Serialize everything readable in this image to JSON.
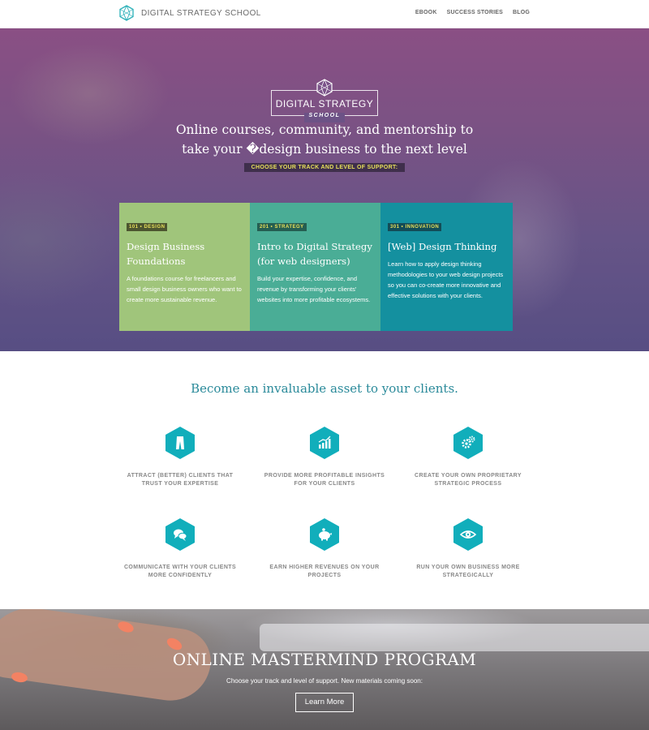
{
  "nav": {
    "logo_text": "DIGITAL STRATEGY SCHOOL",
    "links": [
      "EBOOK",
      "SUCCESS STORIES",
      "BLOG"
    ]
  },
  "hero": {
    "badge_line1": "DIGITAL STRATEGY",
    "badge_line2": "SCHOOL",
    "heading_line1": "Online courses, community, and mentorship to",
    "heading_line2": "take your �design business to the next level",
    "cta_label": "CHOOSE YOUR TRACK AND LEVEL OF SUPPORT:",
    "tracks": [
      {
        "tag": "101 • DESIGN",
        "title": "Design Business Foundations",
        "desc": "A foundations course for freelancers and small design business owners who want to create more sustainable revenue.",
        "color": "#a0c57b"
      },
      {
        "tag": "201 • STRATEGY",
        "title": "Intro to Digital Strategy (for web designers)",
        "desc": "Build your expertise, confidence, and revenue by transforming your clients' websites into more profitable ecosystems.",
        "color": "#4aad96"
      },
      {
        "tag": "301 • INNOVATION",
        "title": "[Web] Design Thinking",
        "desc": "Learn how to apply design thinking methodologies to your web design projects so you can co-create more innovative and effective solutions with your clients.",
        "color": "#14909f"
      }
    ]
  },
  "benefits": {
    "heading": "Become an invaluable asset to your clients.",
    "items": [
      {
        "icon": "pants-icon",
        "label": "ATTRACT (BETTER) CLIENTS THAT TRUST YOUR EXPERTISE"
      },
      {
        "icon": "growth-chart-icon",
        "label": "PROVIDE MORE PROFITABLE INSIGHTS FOR YOUR CLIENTS"
      },
      {
        "icon": "gears-icon",
        "label": "CREATE YOUR OWN PROPRIETARY STRATEGIC PROCESS"
      },
      {
        "icon": "chat-bubbles-icon",
        "label": "COMMUNICATE WITH YOUR CLIENTS MORE CONFIDENTLY"
      },
      {
        "icon": "piggy-bank-icon",
        "label": "EARN HIGHER REVENUES ON YOUR PROJECTS"
      },
      {
        "icon": "eye-icon",
        "label": "RUN YOUR OWN BUSINESS MORE STRATEGICALLY"
      }
    ],
    "accent": "#11aebb"
  },
  "mastermind": {
    "title": "ONLINE MASTERMIND PROGRAM",
    "subtitle": "Choose your track and level of support. New materials coming soon:",
    "button": "Learn More"
  }
}
